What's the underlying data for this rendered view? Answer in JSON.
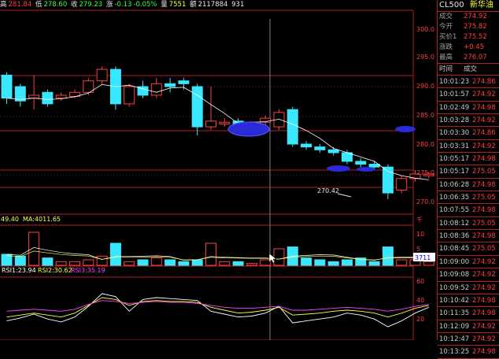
{
  "header": {
    "high_label": "高",
    "high": "281.84",
    "low_label": "低",
    "low": "278.60",
    "close_label": "收",
    "close": "279.23",
    "chg_label": "涨",
    "chg": "-0.13",
    "chg_pct": "-0.05%",
    "vol_label": "量",
    "vol": "7551",
    "amount_label": "额",
    "amount": "2117884",
    "extra": "931"
  },
  "kline": {
    "price_ticks": [
      "300.0",
      "295.0",
      "290.0",
      "285.0",
      "280.0",
      "275.0",
      "270.0"
    ],
    "low_annotation": "270.42",
    "colors": {
      "up": "#ff4040",
      "down": "#39e7ff",
      "grid": "#b02020",
      "ma": "#ffffff",
      "marker": "#2a2ad8"
    }
  },
  "volume": {
    "indicator_text": "49.40",
    "ma_label": "MA:4011.65",
    "unit_label": "千",
    "ticks": [
      "10",
      "5"
    ],
    "current_value": "3711"
  },
  "rsi": {
    "rsi1": "RSI1:23.94",
    "rsi2": "RSI2:30.62",
    "rsi3": "RSI3:35.19",
    "ticks": [
      "60",
      "40",
      "20"
    ]
  },
  "quote": {
    "symbol": "CL500",
    "name": "新华油",
    "rows": [
      {
        "label": "成交",
        "value": "274.92"
      },
      {
        "label": "今开",
        "value": "275.82"
      },
      {
        "label": "买价1",
        "value": "275.52"
      },
      {
        "label": "涨跌",
        "value": "+0.45"
      },
      {
        "label": "最高",
        "value": "276.07"
      }
    ]
  },
  "ticks_table": {
    "header_time": "时间",
    "header_price": "成交",
    "rows": [
      {
        "time": "10:01:23",
        "price": "274.86"
      },
      {
        "time": "10:01:57",
        "price": "274.92"
      },
      {
        "time": "10:02:49",
        "price": "274.98"
      },
      {
        "time": "10:03:28",
        "price": "274.92"
      },
      {
        "time": "10:03:30",
        "price": "274.86"
      },
      {
        "time": "10:03:31",
        "price": "274.92"
      },
      {
        "time": "10:05:17",
        "price": "274.98"
      },
      {
        "time": "10:05:17",
        "price": "275.05"
      },
      {
        "time": "10:06:28",
        "price": "274.98"
      },
      {
        "time": "10:06:35",
        "price": "275.05"
      },
      {
        "time": "10:07:55",
        "price": "274.98"
      },
      {
        "time": "10:08:12",
        "price": "275.05"
      },
      {
        "time": "10:08:36",
        "price": "274.98"
      },
      {
        "time": "10:08:45",
        "price": "275.05"
      },
      {
        "time": "10:09:00",
        "price": "274.92"
      },
      {
        "time": "10:09:08",
        "price": "274.92"
      },
      {
        "time": "10:09:52",
        "price": "274.92"
      },
      {
        "time": "10:10:42",
        "price": "274.98"
      },
      {
        "time": "10:11:35",
        "price": "274.98"
      },
      {
        "time": "10:12:09",
        "price": "274.92"
      },
      {
        "time": "10:12:47",
        "price": "274.92"
      },
      {
        "time": "10:13:25",
        "price": "274.98"
      }
    ]
  },
  "candles": [
    {
      "o": 292.0,
      "c": 288.0,
      "h": 292.5,
      "l": 287.0
    },
    {
      "o": 290.0,
      "c": 287.5,
      "h": 290.5,
      "l": 286.5
    },
    {
      "o": 288.0,
      "c": 288.5,
      "h": 292.0,
      "l": 286.0
    },
    {
      "o": 289.0,
      "c": 287.0,
      "h": 289.5,
      "l": 286.5
    },
    {
      "o": 288.0,
      "c": 288.5,
      "h": 289.0,
      "l": 287.5
    },
    {
      "o": 288.3,
      "c": 289.0,
      "h": 289.5,
      "l": 288.0
    },
    {
      "o": 289.0,
      "c": 291.0,
      "h": 291.5,
      "l": 288.5
    },
    {
      "o": 291.0,
      "c": 293.0,
      "h": 293.5,
      "l": 290.5
    },
    {
      "o": 293.0,
      "c": 287.0,
      "h": 293.5,
      "l": 286.0
    },
    {
      "o": 287.0,
      "c": 290.0,
      "h": 290.5,
      "l": 286.5
    },
    {
      "o": 290.0,
      "c": 288.5,
      "h": 291.0,
      "l": 288.0
    },
    {
      "o": 288.5,
      "c": 290.5,
      "h": 291.5,
      "l": 288.0
    },
    {
      "o": 290.5,
      "c": 290.0,
      "h": 291.5,
      "l": 289.0
    },
    {
      "o": 291.0,
      "c": 290.5,
      "h": 291.5,
      "l": 289.5
    },
    {
      "o": 290.0,
      "c": 283.0,
      "h": 290.5,
      "l": 281.5
    },
    {
      "o": 283.0,
      "c": 284.0,
      "h": 290.0,
      "l": 282.5
    },
    {
      "o": 283.5,
      "c": 283.8,
      "h": 284.5,
      "l": 283.0
    },
    {
      "o": 284.0,
      "c": 283.5,
      "h": 284.5,
      "l": 282.5
    },
    {
      "o": 283.5,
      "c": 283.8,
      "h": 284.0,
      "l": 283.0
    },
    {
      "o": 283.8,
      "c": 284.5,
      "h": 285.0,
      "l": 283.0
    },
    {
      "o": 283.0,
      "c": 285.5,
      "h": 286.0,
      "l": 282.5
    },
    {
      "o": 286.0,
      "c": 280.0,
      "h": 286.5,
      "l": 279.5
    },
    {
      "o": 280.0,
      "c": 279.5,
      "h": 280.5,
      "l": 279.0
    },
    {
      "o": 279.5,
      "c": 279.0,
      "h": 280.0,
      "l": 278.5
    },
    {
      "o": 279.0,
      "c": 278.5,
      "h": 279.5,
      "l": 278.0
    },
    {
      "o": 278.5,
      "c": 277.0,
      "h": 279.0,
      "l": 276.5
    },
    {
      "o": 277.0,
      "c": 276.5,
      "h": 277.5,
      "l": 276.0
    },
    {
      "o": 276.5,
      "c": 276.0,
      "h": 277.0,
      "l": 275.5
    },
    {
      "o": 276.0,
      "c": 271.5,
      "h": 276.5,
      "l": 270.42
    },
    {
      "o": 272.0,
      "c": 274.0,
      "h": 274.5,
      "l": 271.5
    },
    {
      "o": 274.0,
      "c": 274.8,
      "h": 275.5,
      "l": 273.5
    },
    {
      "o": 274.5,
      "c": 274.8,
      "h": 275.2,
      "l": 274.0
    }
  ],
  "volumes": [
    3,
    2.5,
    9,
    2,
    1,
    1,
    1.5,
    2.5,
    6,
    1,
    1.5,
    2,
    1.5,
    1,
    1.5,
    6,
    1,
    1,
    0.5,
    1.5,
    4.5,
    5,
    2,
    1.5,
    1,
    1.5,
    2,
    1,
    5,
    1.5,
    1.5,
    1
  ],
  "rsi_series": {
    "rsi1": [
      20,
      23,
      27,
      22,
      19,
      24,
      35,
      48,
      45,
      30,
      42,
      44,
      43,
      42,
      41,
      30,
      27,
      24,
      25,
      28,
      35,
      18,
      20,
      22,
      24,
      28,
      26,
      22,
      14,
      20,
      28,
      34
    ],
    "rsi2": [
      24,
      26,
      28,
      26,
      24,
      28,
      36,
      44,
      42,
      36,
      40,
      41,
      40,
      40,
      39,
      34,
      31,
      28,
      29,
      31,
      34,
      26,
      27,
      28,
      30,
      31,
      30,
      28,
      24,
      28,
      33,
      36
    ],
    "rsi3": [
      30,
      31,
      32,
      31,
      30,
      32,
      37,
      41,
      40,
      38,
      39,
      40,
      39,
      39,
      38,
      36,
      34,
      33,
      33,
      34,
      35,
      31,
      31,
      32,
      33,
      34,
      33,
      32,
      30,
      32,
      35,
      37
    ]
  }
}
